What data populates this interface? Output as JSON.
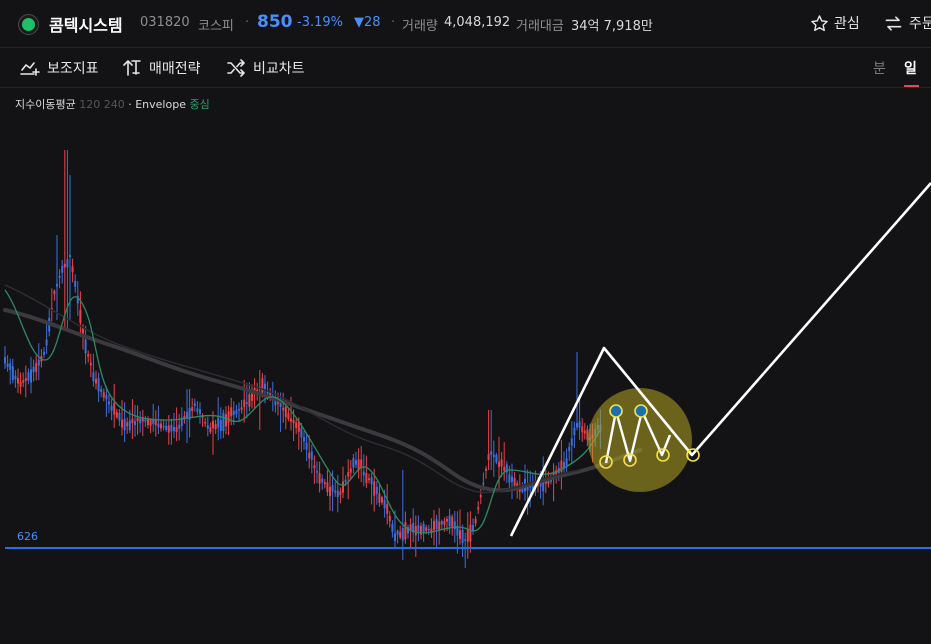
{
  "header": {
    "stock_name": "콤텍시스템",
    "code": "031820",
    "market": "코스피",
    "price": "850",
    "change_rate": "-3.19%",
    "change_amount": "▼28",
    "volume_label": "거래량",
    "volume": "4,048,192",
    "amount_label": "거래대금",
    "amount": "34억 7,918만",
    "watch_label": "관심",
    "order_label": "주문",
    "logo_icon": "comtec-logo-icon"
  },
  "toolbar": {
    "indicators_label": "보조지표",
    "strategy_label": "매매전략",
    "compare_label": "비교차트",
    "period_minute": "분",
    "period_day": "일",
    "active_period": "일"
  },
  "legend": {
    "ma_label": "지수이동평균",
    "ma_periods": "120 240",
    "separator": "·",
    "envelope_label": "Envelope",
    "envelope_mode": "중심"
  },
  "chart_data": {
    "type": "candlestick",
    "horizontal_line": {
      "value": 626,
      "label": "626",
      "color": "#1e6fe8"
    },
    "colors": {
      "up": "#e8434a",
      "down": "#3b6fe0",
      "ma_fast": "#2f8a63",
      "ma_slow": "#3a3a3f",
      "drawing": "#ffffff",
      "highlight": "#b5a520"
    },
    "annotations": [
      "white trend-line drawing (rising to a peak, dropping, then rising steeply to the right edge)",
      "zigzag double-top pattern with two circled highs and four circled lows inside a yellow highlight"
    ]
  }
}
